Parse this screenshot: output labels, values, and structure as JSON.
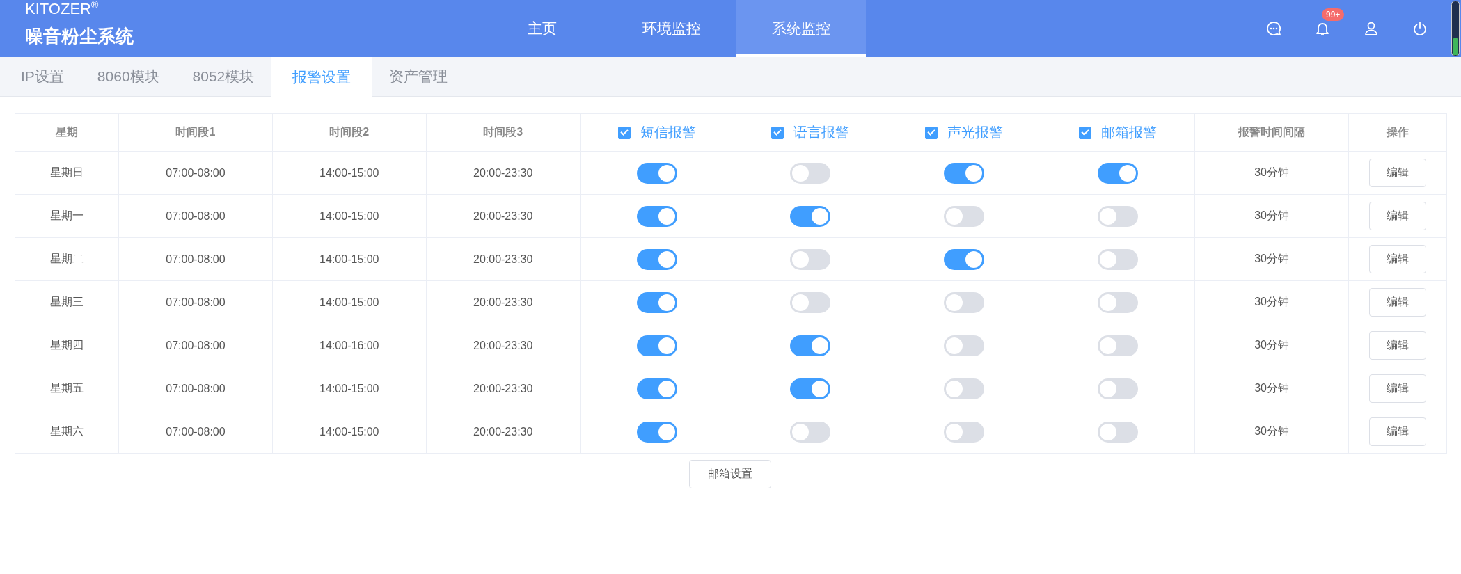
{
  "header": {
    "brand": "KITOZER$^{®}$",
    "title": "噪音粉尘系统",
    "nav": [
      {
        "label": "主页",
        "selected": false
      },
      {
        "label": "环境监控",
        "selected": false
      },
      {
        "label": "系统监控",
        "selected": true
      }
    ],
    "notification_badge": "99+"
  },
  "subtabs": [
    {
      "label": "IP设置",
      "selected": false
    },
    {
      "label": "8060模块",
      "selected": false
    },
    {
      "label": "8052模块",
      "selected": false
    },
    {
      "label": "报警设置",
      "selected": true
    },
    {
      "label": "资产管理",
      "selected": false
    }
  ],
  "table": {
    "columns": [
      {
        "kind": "text",
        "label": "星期"
      },
      {
        "kind": "text",
        "label": "时间段1"
      },
      {
        "kind": "text",
        "label": "时间段2"
      },
      {
        "kind": "text",
        "label": "时间段3"
      },
      {
        "kind": "check",
        "label": "短信报警",
        "checked": true
      },
      {
        "kind": "check",
        "label": "语言报警",
        "checked": true
      },
      {
        "kind": "check",
        "label": "声光报警",
        "checked": true
      },
      {
        "kind": "check",
        "label": "邮箱报警",
        "checked": true
      },
      {
        "kind": "text",
        "label": "报警时间间隔"
      },
      {
        "kind": "text",
        "label": "操作"
      }
    ],
    "rows": [
      {
        "day": "星期日",
        "t1": "07:00-08:00",
        "t2": "14:00-15:00",
        "t3": "20:00-23:30",
        "switches": [
          true,
          false,
          true,
          true
        ],
        "interval": "30分钟",
        "action": "编辑"
      },
      {
        "day": "星期一",
        "t1": "07:00-08:00",
        "t2": "14:00-15:00",
        "t3": "20:00-23:30",
        "switches": [
          true,
          true,
          false,
          false
        ],
        "interval": "30分钟",
        "action": "编辑"
      },
      {
        "day": "星期二",
        "t1": "07:00-08:00",
        "t2": "14:00-15:00",
        "t3": "20:00-23:30",
        "switches": [
          true,
          false,
          true,
          false
        ],
        "interval": "30分钟",
        "action": "编辑"
      },
      {
        "day": "星期三",
        "t1": "07:00-08:00",
        "t2": "14:00-15:00",
        "t3": "20:00-23:30",
        "switches": [
          true,
          false,
          false,
          false
        ],
        "interval": "30分钟",
        "action": "编辑"
      },
      {
        "day": "星期四",
        "t1": "07:00-08:00",
        "t2": "14:00-16:00",
        "t3": "20:00-23:30",
        "switches": [
          true,
          true,
          false,
          false
        ],
        "interval": "30分钟",
        "action": "编辑"
      },
      {
        "day": "星期五",
        "t1": "07:00-08:00",
        "t2": "14:00-15:00",
        "t3": "20:00-23:30",
        "switches": [
          true,
          true,
          false,
          false
        ],
        "interval": "30分钟",
        "action": "编辑"
      },
      {
        "day": "星期六",
        "t1": "07:00-08:00",
        "t2": "14:00-15:00",
        "t3": "20:00-23:30",
        "switches": [
          true,
          false,
          false,
          false
        ],
        "interval": "30分钟",
        "action": "编辑"
      }
    ]
  },
  "footer_button": "邮箱设置"
}
